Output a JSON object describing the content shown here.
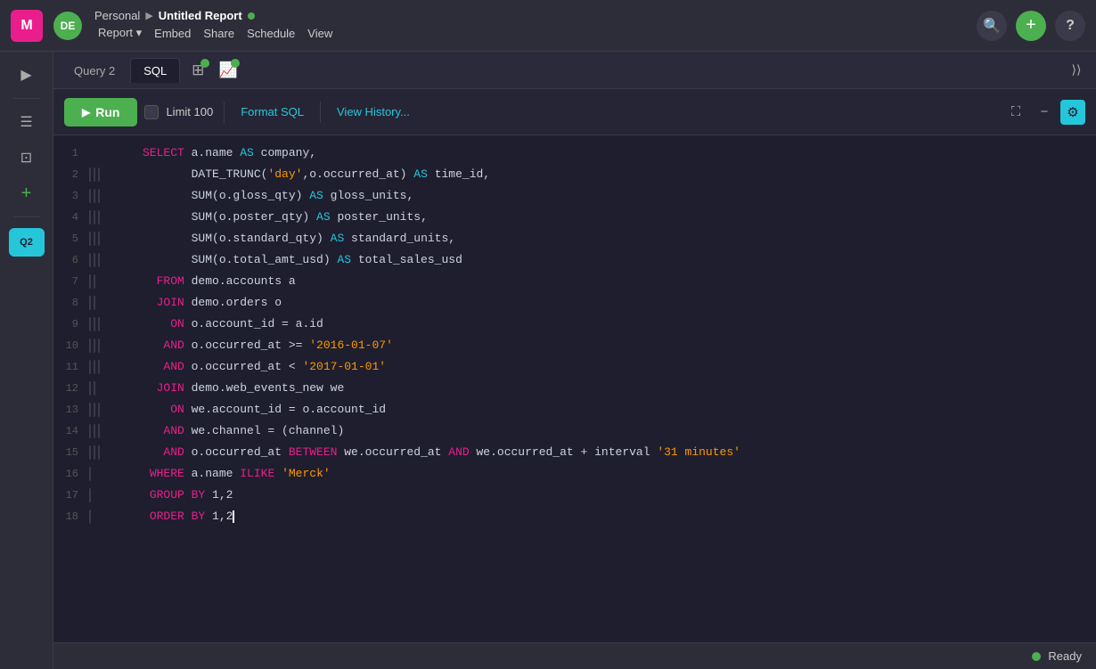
{
  "app": {
    "logo": "M",
    "avatar": "DE",
    "workspace": "Personal",
    "arrow": "▶",
    "report_title": "Untitled Report",
    "status_dot": "●"
  },
  "nav_menu": {
    "report": "Report",
    "report_arrow": "▾",
    "embed": "Embed",
    "share": "Share",
    "schedule": "Schedule",
    "view": "View"
  },
  "nav_icons": {
    "search": "🔍",
    "add": "+",
    "help": "?"
  },
  "tabs": {
    "query2": "Query 2",
    "sql": "SQL",
    "table_icon": "⊞",
    "chart_icon": "📈"
  },
  "toolbar": {
    "run": "Run",
    "limit_label": "Limit 100",
    "format_sql": "Format SQL",
    "view_history": "View History...",
    "expand_icon": "⛶",
    "minimize_icon": "−",
    "settings_icon": "⚙"
  },
  "sql_lines": [
    {
      "num": 1,
      "gutters": 0,
      "code": "SELECT a.name AS company,"
    },
    {
      "num": 2,
      "gutters": 3,
      "code": "       DATE_TRUNC('day',o.occurred_at) AS time_id,"
    },
    {
      "num": 3,
      "gutters": 3,
      "code": "       SUM(o.gloss_qty) AS gloss_units,"
    },
    {
      "num": 4,
      "gutters": 3,
      "code": "       SUM(o.poster_qty) AS poster_units,"
    },
    {
      "num": 5,
      "gutters": 3,
      "code": "       SUM(o.standard_qty) AS standard_units,"
    },
    {
      "num": 6,
      "gutters": 3,
      "code": "       SUM(o.total_amt_usd) AS total_sales_usd"
    },
    {
      "num": 7,
      "gutters": 2,
      "code": "  FROM demo.accounts a"
    },
    {
      "num": 8,
      "gutters": 2,
      "code": "  JOIN demo.orders o"
    },
    {
      "num": 9,
      "gutters": 3,
      "code": "    ON o.account_id = a.id"
    },
    {
      "num": 10,
      "gutters": 3,
      "code": "   AND o.occurred_at >= '2016-01-07'"
    },
    {
      "num": 11,
      "gutters": 3,
      "code": "   AND o.occurred_at < '2017-01-01'"
    },
    {
      "num": 12,
      "gutters": 2,
      "code": "  JOIN demo.web_events_new we"
    },
    {
      "num": 13,
      "gutters": 3,
      "code": "    ON we.account_id = o.account_id"
    },
    {
      "num": 14,
      "gutters": 3,
      "code": "   AND we.channel = (channel)"
    },
    {
      "num": 15,
      "gutters": 3,
      "code": "   AND o.occurred_at BETWEEN we.occurred_at AND we.occurred_at + interval '31 minutes'"
    },
    {
      "num": 16,
      "gutters": 1,
      "code": " WHERE a.name ILIKE 'Merck'"
    },
    {
      "num": 17,
      "gutters": 1,
      "code": " GROUP BY 1,2"
    },
    {
      "num": 18,
      "gutters": 1,
      "code": " ORDER BY 1,2"
    }
  ],
  "sidebar": {
    "expand_icon": "▶",
    "pages_icon": "☰",
    "add_icon": "+",
    "query_badge": "Q2",
    "icon1": "≡",
    "icon2": "⊡"
  },
  "status": {
    "dot_color": "#4caf50",
    "label": "Ready"
  }
}
